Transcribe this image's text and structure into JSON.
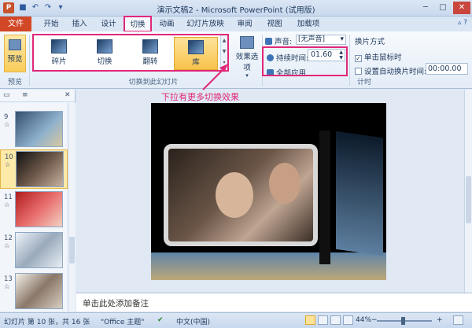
{
  "window": {
    "title": "演示文稿2 - Microsoft PowerPoint (试用版)",
    "app_icon": "P",
    "save_icon": "save-icon",
    "undo_icon": "undo-icon",
    "redo_icon": "redo-icon"
  },
  "tabs": [
    {
      "label": "文件"
    },
    {
      "label": "开始"
    },
    {
      "label": "插入"
    },
    {
      "label": "设计"
    },
    {
      "label": "切换"
    },
    {
      "label": "动画"
    },
    {
      "label": "幻灯片放映"
    },
    {
      "label": "审阅"
    },
    {
      "label": "视图"
    },
    {
      "label": "加载项"
    }
  ],
  "ribbon": {
    "preview_label": "预览",
    "preview_group": "预览",
    "transitions": [
      {
        "label": "碎片"
      },
      {
        "label": "切换"
      },
      {
        "label": "翻转"
      },
      {
        "label": "库"
      }
    ],
    "transitions_group": "切换到此幻灯片",
    "effect_options": "效果选项",
    "sound_label": "声音:",
    "sound_value": "[无声音]",
    "duration_label": "持续时间:",
    "duration_value": "01.60",
    "apply_all": "全部应用",
    "advance_heading": "换片方式",
    "on_click": "单击鼠标时",
    "auto_after": "设置自动换片时间:",
    "auto_value": "00:00.00",
    "timing_group": "计时"
  },
  "annotation": "下拉有更多切换效果",
  "slides": [
    {
      "num": "9",
      "mark": "☆"
    },
    {
      "num": "10",
      "mark": "☆"
    },
    {
      "num": "11",
      "mark": "☆"
    },
    {
      "num": "12",
      "mark": "☆"
    },
    {
      "num": "13",
      "mark": "☆"
    }
  ],
  "notes_placeholder": "单击此处添加备注",
  "status": {
    "slide_info": "幻灯片 第 10 张，共 16 张",
    "theme": "\"Office 主题\"",
    "language": "中文(中国)",
    "zoom": "44%",
    "zoom_out": "−",
    "zoom_in": "+"
  },
  "colors": {
    "accent": "#e0287a",
    "file_tab": "#d24726",
    "selected": "#f9c24c"
  }
}
